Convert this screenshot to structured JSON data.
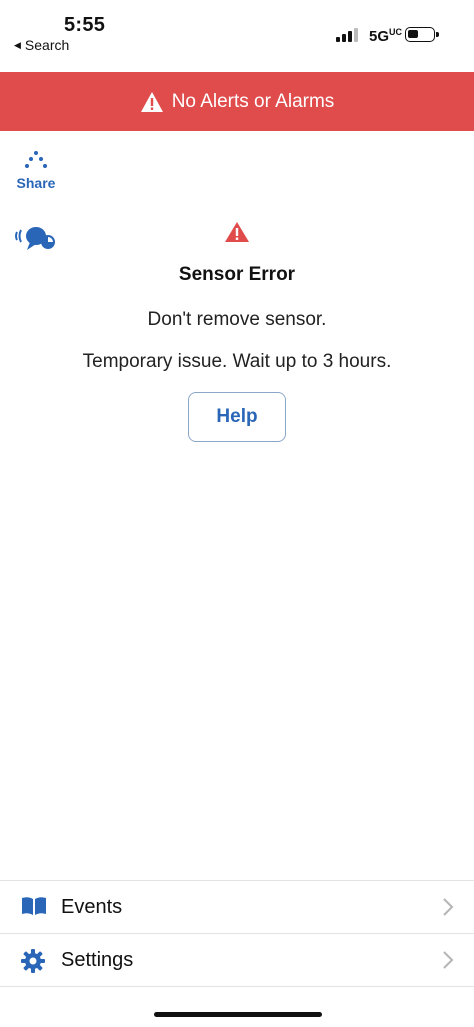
{
  "status_bar": {
    "time": "5:55",
    "back_label": "Search",
    "network": "5G",
    "network_suffix": "UC"
  },
  "alert_banner": {
    "text": "No Alerts or Alarms",
    "color": "#e04b4b"
  },
  "share": {
    "label": "Share"
  },
  "sensor": {
    "title": "Sensor Error",
    "message_1": "Don't remove sensor.",
    "message_2": "Temporary issue. Wait up to 3 hours.",
    "help_label": "Help"
  },
  "menu": {
    "items": [
      {
        "label": "Events",
        "icon": "book-icon"
      },
      {
        "label": "Settings",
        "icon": "gear-icon"
      }
    ]
  },
  "colors": {
    "accent": "#2a66b8",
    "error": "#e04b4b"
  }
}
